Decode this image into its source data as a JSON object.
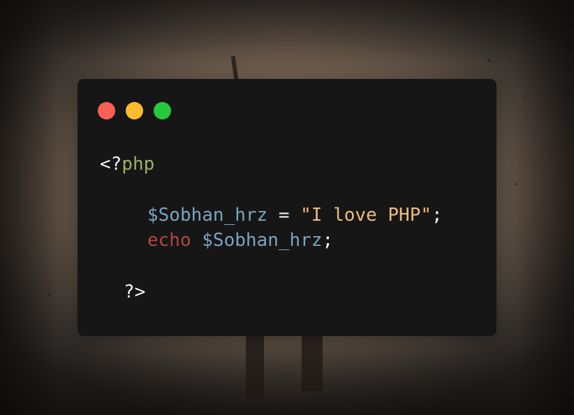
{
  "colors": {
    "window_bg": "#161616",
    "close": "#fe5f57",
    "minimize": "#febb2e",
    "maximize": "#27c840",
    "tag_punct": "#f2f2f2",
    "php_keyword": "#9bb263",
    "variable": "#7aa4bf",
    "string": "#efbc7c",
    "echo_keyword": "#b2473d"
  },
  "window_controls": {
    "close_icon": "red-circle",
    "minimize_icon": "yellow-circle",
    "maximize_icon": "green-circle"
  },
  "code": {
    "open_tag_punct": "<?",
    "open_tag_php": "php",
    "assign_var": "$Sobhan_hrz",
    "assign_op": " = ",
    "assign_string": "\"I love PHP\"",
    "assign_semicolon": ";",
    "echo_keyword": "echo",
    "echo_space": " ",
    "echo_var": "$Sobhan_hrz",
    "echo_semicolon": ";",
    "close_tag": "?>"
  }
}
